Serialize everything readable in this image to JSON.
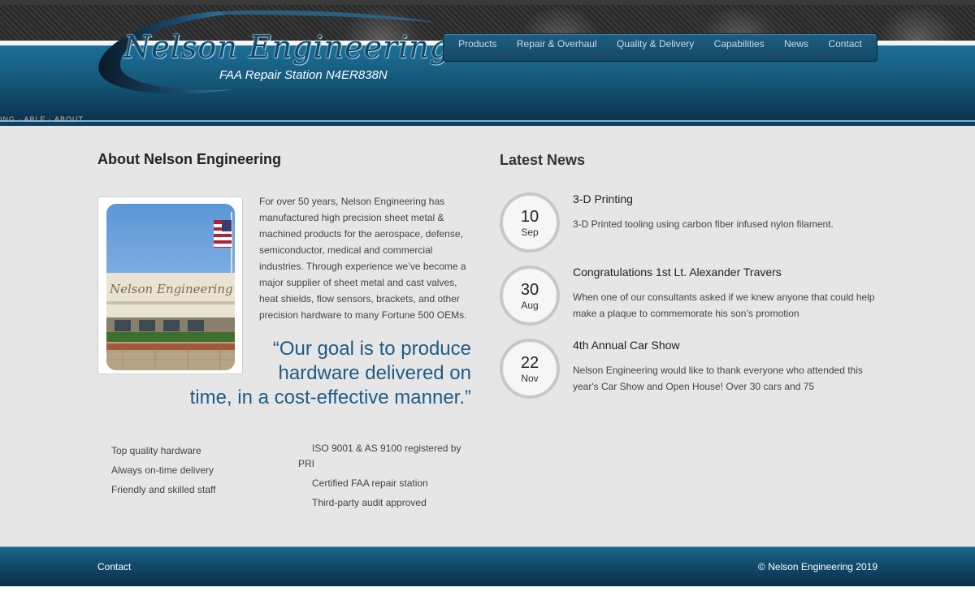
{
  "header": {
    "logo_title": "Nelson Engineering Co.",
    "logo_subtitle": "FAA Repair Station N4ER838N",
    "breadcrumb": "ING · ABLE · ABOUT"
  },
  "nav": {
    "items": [
      "Products",
      "Repair & Overhaul",
      "Quality & Delivery",
      "Capabilities",
      "News",
      "Contact"
    ]
  },
  "about": {
    "title": "About Nelson Engineering",
    "photo_caption": "Nelson Engineering Co.",
    "body": "For over 50 years, Nelson Engineering has manufactured high precision sheet metal & machined products for the aerospace, defense, semiconductor, medical and commercial industries. Through experience we’ve become a major supplier of sheet metal and cast valves, heat shields, flow sensors, brackets, and other precision hardware to many Fortune 500 OEMs.",
    "quote_lines": [
      "“Our goal is to produce",
      "hardware delivered on",
      "time, in a cost-effective manner.”"
    ],
    "features_left": [
      "Top quality hardware",
      "Always on-time delivery",
      "Friendly and skilled staff"
    ],
    "features_right": [
      "ISO 9001 & AS 9100 registered by PRI",
      "Certified FAA repair station",
      "Third-party audit approved"
    ]
  },
  "news": {
    "title": "Latest News",
    "items": [
      {
        "day": "10",
        "month": "Sep",
        "title": "3-D Printing",
        "body": "3-D Printed tooling using carbon fiber infused nylon filament."
      },
      {
        "day": "30",
        "month": "Aug",
        "title": "Congratulations 1st Lt. Alexander Travers",
        "body": "When one of our consultants asked if we knew anyone that could help make a plaque to commemorate his son’s promotion"
      },
      {
        "day": "22",
        "month": "Nov",
        "title": "4th Annual Car Show",
        "body": "Nelson Engineering would like to thank everyone who attended this year's Car Show and Open House! Over 30 cars and 75"
      }
    ]
  },
  "footer": {
    "contact_label": "Contact",
    "copyright": "© Nelson Engineering 2019"
  },
  "colors": {
    "header_blue": "#155879",
    "quote_blue": "#1f5b84",
    "page_bg": "#e6e6e6"
  }
}
